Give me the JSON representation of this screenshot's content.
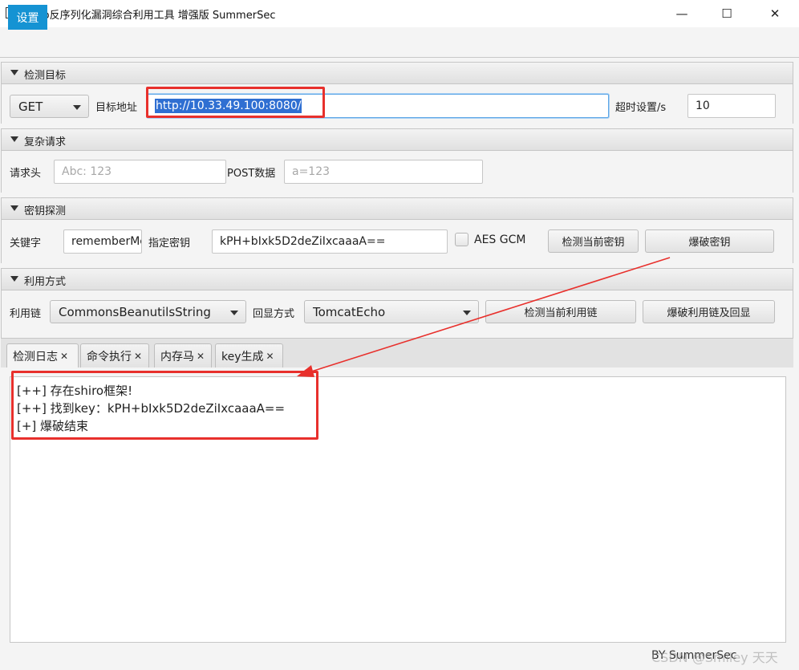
{
  "window": {
    "title": "shiro反序列化漏洞综合利用工具 增强版 SummerSec",
    "minimize": "—",
    "maximize": "☐",
    "close": "✕"
  },
  "menu": {
    "settings": "设置"
  },
  "target": {
    "header": "检测目标",
    "method": "GET",
    "url_label": "目标地址",
    "url_value": "http://10.33.49.100:8080/",
    "timeout_label": "超时设置/s",
    "timeout_value": "10"
  },
  "complex": {
    "header": "复杂请求",
    "headers_label": "请求头",
    "headers_placeholder": "Abc: 123",
    "post_label": "POST数据",
    "post_placeholder": "a=123"
  },
  "key": {
    "header": "密钥探测",
    "keyword_label": "关键字",
    "keyword_value": "rememberMe",
    "specify_label": "指定密钥",
    "specify_value": "kPH+bIxk5D2deZiIxcaaaA==",
    "aes_gcm_label": "AES GCM",
    "detect_btn": "检测当前密钥",
    "brute_btn": "爆破密钥"
  },
  "exploit": {
    "header": "利用方式",
    "chain_label": "利用链",
    "chain_value": "CommonsBeanutilsString",
    "echo_label": "回显方式",
    "echo_value": "TomcatEcho",
    "detect_chain_btn": "检测当前利用链",
    "brute_chain_btn": "爆破利用链及回显"
  },
  "tabs": [
    {
      "label": "检测日志"
    },
    {
      "label": "命令执行"
    },
    {
      "label": "内存马"
    },
    {
      "label": "key生成"
    }
  ],
  "tab_close": "✕",
  "log": {
    "lines": [
      "[++] 存在shiro框架!",
      "[++] 找到key：kPH+bIxk5D2deZiIxcaaaA==",
      "[+] 爆破结束"
    ]
  },
  "footer": {
    "text": "BY SummerSec"
  },
  "watermark": "CSDN @Smiley 天天",
  "colors": {
    "accent": "#1593d3",
    "annotation": "#e8302c"
  }
}
